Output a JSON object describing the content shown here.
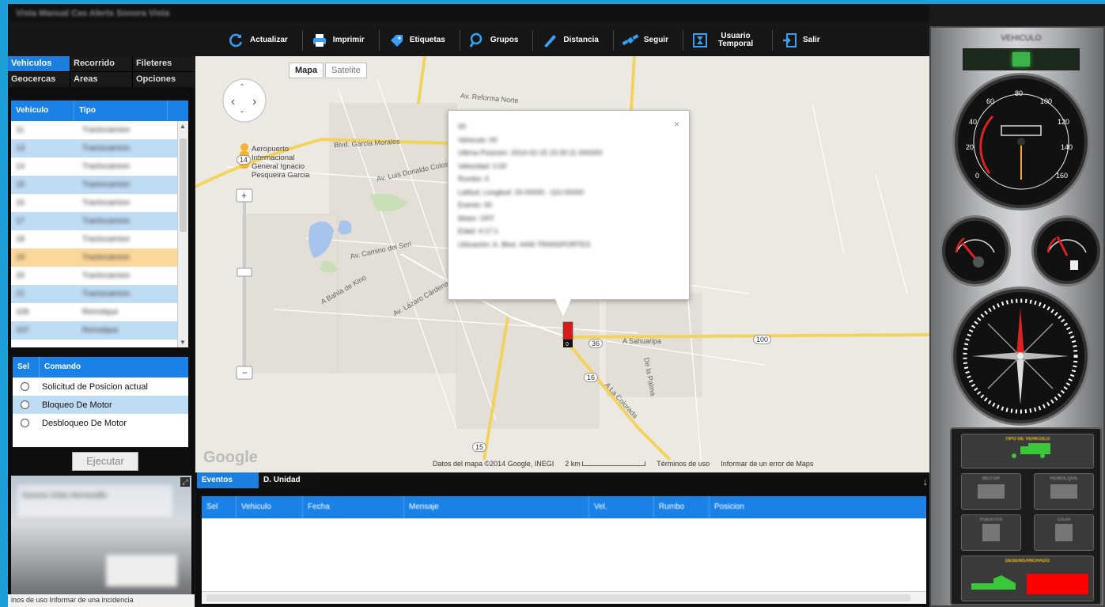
{
  "window": {
    "title": "Vista Manual Cas Alerts Sonora Vista"
  },
  "toolbar": {
    "buttons": [
      {
        "label": "Actualizar",
        "icon": "refresh-icon"
      },
      {
        "label": "Imprimir",
        "icon": "printer-icon"
      },
      {
        "label": "Etiquetas",
        "icon": "tag-icon"
      },
      {
        "label": "Grupos",
        "icon": "group-search-icon"
      },
      {
        "label": "Distancia",
        "icon": "ruler-pencil-icon"
      },
      {
        "label": "Seguir",
        "icon": "satellite-icon"
      },
      {
        "label": "Usuario Temporal",
        "icon": "temp-user-icon"
      },
      {
        "label": "Salir",
        "icon": "exit-icon"
      }
    ]
  },
  "left_tabs": [
    "Vehiculos",
    "Recorrido",
    "Fileteres",
    "Geocercas",
    "Areas",
    "Opciones"
  ],
  "vehicle_grid": {
    "headers": [
      "Vehiculo",
      "Tipo"
    ],
    "rows": [
      [
        "11",
        "Tractocamion"
      ],
      [
        "13",
        "Tractocamion"
      ],
      [
        "14",
        "Tractocamion"
      ],
      [
        "15",
        "Tractocamion"
      ],
      [
        "16",
        "Tractocamion"
      ],
      [
        "17",
        "Tractocamion"
      ],
      [
        "18",
        "Tractocamion"
      ],
      [
        "19",
        "Tractocamion"
      ],
      [
        "20",
        "Tractocamion"
      ],
      [
        "21",
        "Tractocamion"
      ],
      [
        "106",
        "Remolque"
      ],
      [
        "107",
        "Remolque"
      ]
    ],
    "selected_index": 7
  },
  "command_grid": {
    "headers": [
      "Sel",
      "Comando"
    ],
    "commands": [
      "Solicitud de Posicion actual",
      "Bloqueo De Motor",
      "Desbloqueo De Motor"
    ],
    "selected_index": 1
  },
  "execute_label": "Ejecutar",
  "thumbnail_caption": "Sonora Vista Hermosillo",
  "left_footer": "inos de uso  Informar de una incidencia",
  "map": {
    "type_buttons": [
      "Mapa",
      "Satelite"
    ],
    "airport_label": "Aeropuerto Internacional General Ignacio Pesqueira Garcia",
    "road_labels": [
      "Blvd. Garcia Morales",
      "Av. Luis Donaldo Colosio",
      "Av. Camino del Seri",
      "Av. Lázaro Cárdenas",
      "A Bahía de Kino",
      "A Sahuaripa",
      "A La Colorada",
      "De la Palma",
      "Av. Reforma Norte"
    ],
    "route_shields": [
      "36",
      "100",
      "16",
      "15",
      "14"
    ],
    "google_label": "Google",
    "footer": [
      "Datos del mapa ©2014 Google, INEGI",
      "2 km",
      "Términos de uso",
      "Informar de un error de Maps"
    ]
  },
  "popup": {
    "lines": [
      "00",
      "Vehículo: 00",
      "Ultima Posición: 2014-02-15 15:30:11 000000",
      "Velocidad: 0.00",
      "Rumbo: 0",
      "Latitud, Longitud: 29.00000, -110.00000",
      "Evento: 00",
      "Motor: OFF",
      "Edad: 4:17:1",
      "Ubicación: A. Blvd. 4446 TRANSPORTES"
    ]
  },
  "events": {
    "tabs": [
      "Eventos",
      "D. Unidad"
    ],
    "headers": [
      "Sel",
      "Vehiculo",
      "Fecha",
      "Mensaje",
      "Vel.",
      "Rumbo",
      "Posicion"
    ]
  },
  "dashboard": {
    "title": "VEHICULO",
    "speed_ticks": [
      "0",
      "20",
      "40",
      "60",
      "80",
      "100",
      "120",
      "140",
      "160"
    ],
    "panels": [
      "TIPO DE VEHICULO",
      "MOTOR",
      "REMOLQUE",
      "PUERTAS",
      "CAJA",
      "DESENGANCHADO"
    ],
    "colors": {
      "indicator": "#3bb34a",
      "truck": "#3ac83a",
      "alert": "#ff0000",
      "accent": "#1b7fe0"
    }
  }
}
